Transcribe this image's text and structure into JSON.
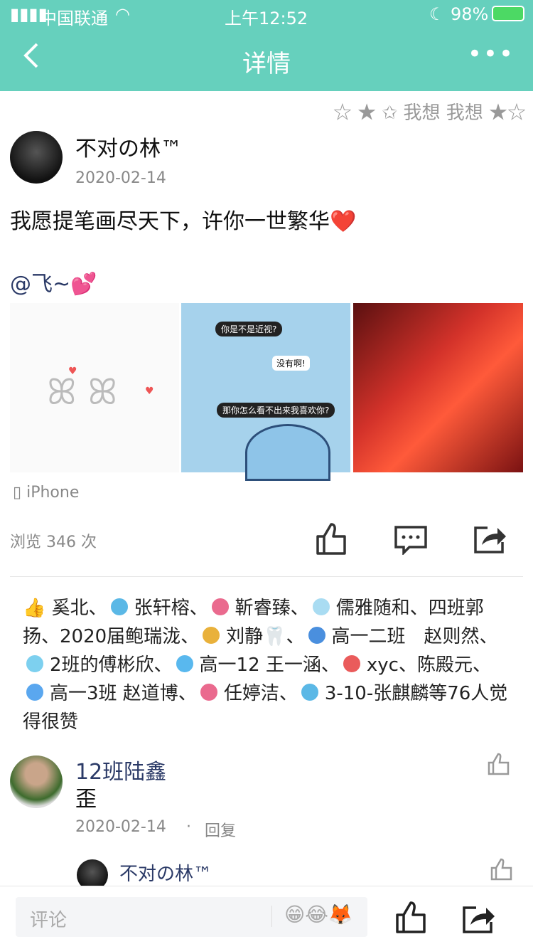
{
  "status_bar": {
    "carrier": "中国联通",
    "time": "上午12:52",
    "battery": "98%"
  },
  "nav": {
    "title": "详情",
    "back_icon": "chevron-left-icon",
    "more_icon": "more-icon"
  },
  "decoration": {
    "text": "我想 我想"
  },
  "post": {
    "author": "不对の林™",
    "date": "2020-02-14",
    "text": "我愿提笔画尽天下，许你一世繁华❤️",
    "mention": "@飞~💕",
    "images": [
      "bunnies",
      "cat-chat",
      "red-ribbons"
    ],
    "image_texts": {
      "cat_1": "你是不是近视?",
      "cat_2": "没有啊!",
      "cat_3": "那你怎么看不出来我喜欢你?"
    },
    "device": "iPhone",
    "views": "浏览 346 次"
  },
  "likes": {
    "names": [
      "奚北、",
      "张轩榕、",
      "靳睿臻、",
      "儒雅随和、四班郭扬、2020届鲍瑞泷、",
      "刘静🦷、",
      "高一二班　赵则然、",
      "2班的傅彬欣、",
      "高一12 王一涵、",
      "xyc、陈殿元、",
      "高一3班 赵道博、",
      "任婷洁、",
      "3-10-张麒麟等76人觉得很赞"
    ],
    "badge_colors": [
      "#5bb8e6",
      "#ea6a8e",
      "#a9dcf2",
      "#e9b13b",
      "#4a8fde",
      "#7dd0ef",
      "#59b8ee",
      "#ea5b5b",
      "#5aa7ef",
      "#ea6a8e",
      "#5bb8e6"
    ]
  },
  "comments": [
    {
      "author": "12班陆鑫",
      "text": "歪",
      "date": "2020-02-14",
      "reply": "回复"
    },
    {
      "author": "不对の林™"
    }
  ],
  "bottom_bar": {
    "placeholder": "评论",
    "emojis": "😁😂🦊"
  },
  "colors": {
    "header": "#66d0bd",
    "name_blue": "#2b3a67"
  }
}
